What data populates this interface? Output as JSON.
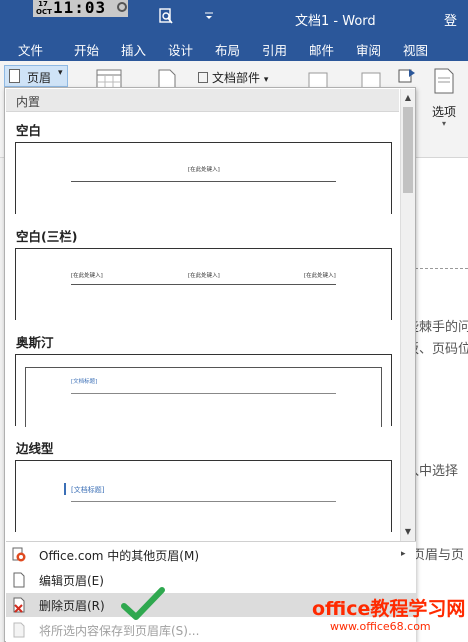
{
  "titlebar": {
    "clock_date_day": "17",
    "clock_date_month": "OCT",
    "clock_time": "11:03",
    "doc_title": "文档1 - Word",
    "corner_text": "登"
  },
  "tabs": [
    "文件",
    "开始",
    "插入",
    "设计",
    "布局",
    "引用",
    "邮件",
    "审阅",
    "视图"
  ],
  "ribbon": {
    "header_button": "页眉",
    "doc_parts_button": "文档部件",
    "options_button": "选项"
  },
  "gallery": {
    "section_label": "内置",
    "categories": [
      {
        "name": "空白",
        "placeholders": [
          "[在此处键入]"
        ]
      },
      {
        "name": "空白(三栏)",
        "placeholders": [
          "[在此处键入]",
          "[在此处键入]",
          "[在此处键入]"
        ]
      },
      {
        "name": "奥斯汀",
        "placeholders": [
          "[文档标题]"
        ]
      },
      {
        "name": "边线型",
        "placeholders": [
          "[文档标题]"
        ]
      }
    ]
  },
  "menu": {
    "items": [
      {
        "label": "Office.com 中的其他页眉(M)",
        "icon": "office-globe-icon",
        "has_submenu": true,
        "state": "normal"
      },
      {
        "label": "编辑页眉(E)",
        "icon": "page-icon",
        "has_submenu": false,
        "state": "normal"
      },
      {
        "label": "删除页眉(R)",
        "icon": "delete-page-icon",
        "has_submenu": false,
        "state": "highlighted"
      },
      {
        "label": "将所选内容保存到页眉库(S)...",
        "icon": "save-page-icon",
        "has_submenu": false,
        "state": "disabled"
      }
    ]
  },
  "document_text": {
    "line1": "些棘手的问",
    "line2": "板、页码位",
    "line3": "入中选择",
    "line4": "\"页眉与页"
  },
  "watermark": {
    "main": "office教程学习网",
    "url": "www.office68.com"
  },
  "colors": {
    "title_blue": "#2b579a",
    "hover_bg": "#cfe3f7",
    "check_green": "#2fa84f",
    "watermark_red": "#ff2a00"
  }
}
